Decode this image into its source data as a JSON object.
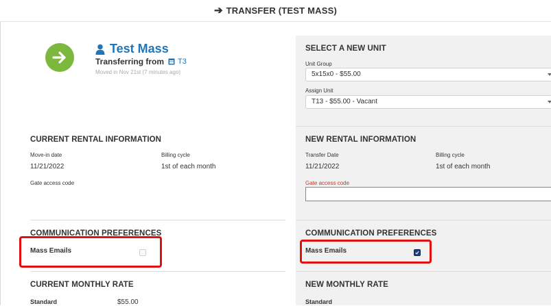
{
  "header": {
    "arrow": "➔",
    "title": "TRANSFER (TEST MASS)"
  },
  "tenant": {
    "name": "Test Mass",
    "transferring_from_label": "Transferring from",
    "from_unit": "T3",
    "moved_in_note": "Moved in Nov 21st (7 minutes ago)",
    "avatar_color": "#7cb83d"
  },
  "current_rental": {
    "title": "CURRENT RENTAL INFORMATION",
    "move_in_label": "Move-in date",
    "move_in_value": "11/21/2022",
    "billing_label": "Billing cycle",
    "billing_value": "1st of each month",
    "gate_label": "Gate access code"
  },
  "new_unit": {
    "title": "SELECT A NEW UNIT",
    "unit_group_label": "Unit Group",
    "unit_group_value": "5x15x0 - $55.00",
    "assign_unit_label": "Assign Unit",
    "assign_unit_value": "T13 - $55.00 - Vacant"
  },
  "new_rental": {
    "title": "NEW RENTAL INFORMATION",
    "transfer_date_label": "Transfer Date",
    "transfer_date_value": "11/21/2022",
    "billing_label": "Billing cycle",
    "billing_value": "1st of each month",
    "gate_label": "Gate access code",
    "gate_value": ""
  },
  "comm_left": {
    "title": "COMMUNICATION PREFERENCES",
    "mass_emails_label": "Mass Emails",
    "mass_emails_checked": false
  },
  "comm_right": {
    "title": "COMMUNICATION PREFERENCES",
    "mass_emails_label": "Mass Emails",
    "mass_emails_checked": true
  },
  "current_rate": {
    "title": "CURRENT MONTHLY RATE",
    "standard_label": "Standard",
    "standard_value": "$55.00"
  },
  "new_rate": {
    "title": "NEW MONTHLY RATE",
    "standard_label": "Standard"
  },
  "colors": {
    "accent": "#1f75b8",
    "highlight": "#e01010",
    "panel": "#f1f1f1"
  }
}
